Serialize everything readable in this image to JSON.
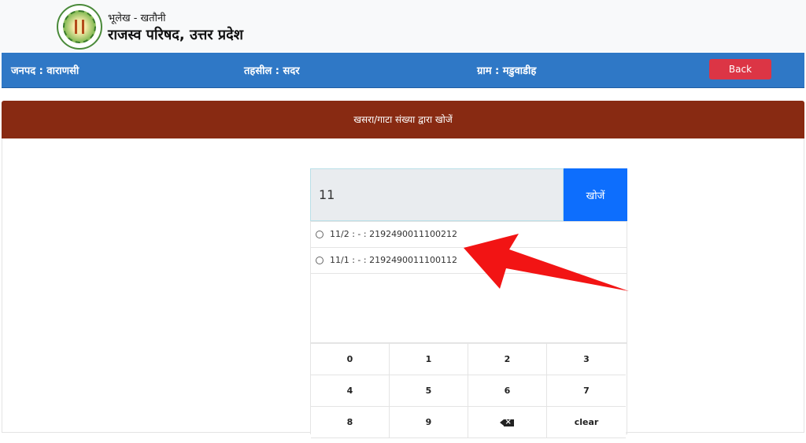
{
  "header": {
    "subtitle": "भूलेख - खतौनी",
    "title": "राजस्व परिषद, उत्तर प्रदेश",
    "logo_icon": "emblem-seal-icon"
  },
  "info_bar": {
    "district": "जनपद : वाराणसी",
    "tehsil": "तहसील : सदर",
    "village": "ग्राम : मडुवाडीह",
    "back_label": "Back"
  },
  "section": {
    "title": "खसरा/गाटा संख्या द्वारा खोजें"
  },
  "search": {
    "value": "11",
    "button_label": "खोजें"
  },
  "results": [
    {
      "label": "11/2 : - : 2192490011100212"
    },
    {
      "label": "11/1 : - : 2192490011100112"
    }
  ],
  "keypad": {
    "keys": [
      "0",
      "1",
      "2",
      "3",
      "4",
      "5",
      "6",
      "7",
      "8",
      "9",
      "backspace-icon",
      "clear"
    ]
  },
  "annotation": {
    "icon": "red-arrow-icon",
    "color": "#f21414"
  },
  "colors": {
    "info_bar": "#2f78c6",
    "section_bar": "#882a12",
    "back_button": "#dc3545",
    "search_button": "#0d6efd"
  }
}
